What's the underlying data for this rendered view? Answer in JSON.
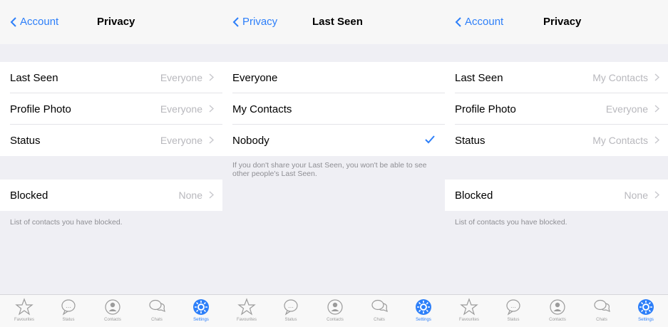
{
  "accent": "#2d7ff9",
  "panel1": {
    "back": "Account",
    "title": "Privacy",
    "rows": [
      {
        "label": "Last Seen",
        "value": "Everyone"
      },
      {
        "label": "Profile Photo",
        "value": "Everyone"
      },
      {
        "label": "Status",
        "value": "Everyone"
      }
    ],
    "blocked": {
      "label": "Blocked",
      "value": "None"
    },
    "footnote": "List of contacts you have blocked."
  },
  "panel2": {
    "back": "Privacy",
    "title": "Last Seen",
    "options": [
      {
        "label": "Everyone",
        "selected": false
      },
      {
        "label": "My Contacts",
        "selected": false
      },
      {
        "label": "Nobody",
        "selected": true
      }
    ],
    "footnote": "If you don't share your Last Seen, you won't be able to see other people's Last Seen."
  },
  "panel3": {
    "back": "Account",
    "title": "Privacy",
    "rows": [
      {
        "label": "Last Seen",
        "value": "My Contacts"
      },
      {
        "label": "Profile Photo",
        "value": "Everyone"
      },
      {
        "label": "Status",
        "value": "My Contacts"
      }
    ],
    "blocked": {
      "label": "Blocked",
      "value": "None"
    },
    "footnote": "List of contacts you have blocked."
  },
  "tabs": [
    {
      "label": "Favourites",
      "icon": "star-icon"
    },
    {
      "label": "Status",
      "icon": "speech-bubble-icon"
    },
    {
      "label": "Contacts",
      "icon": "contacts-icon"
    },
    {
      "label": "Chats",
      "icon": "chats-icon"
    },
    {
      "label": "Settings",
      "icon": "gear-icon",
      "active": true
    }
  ]
}
